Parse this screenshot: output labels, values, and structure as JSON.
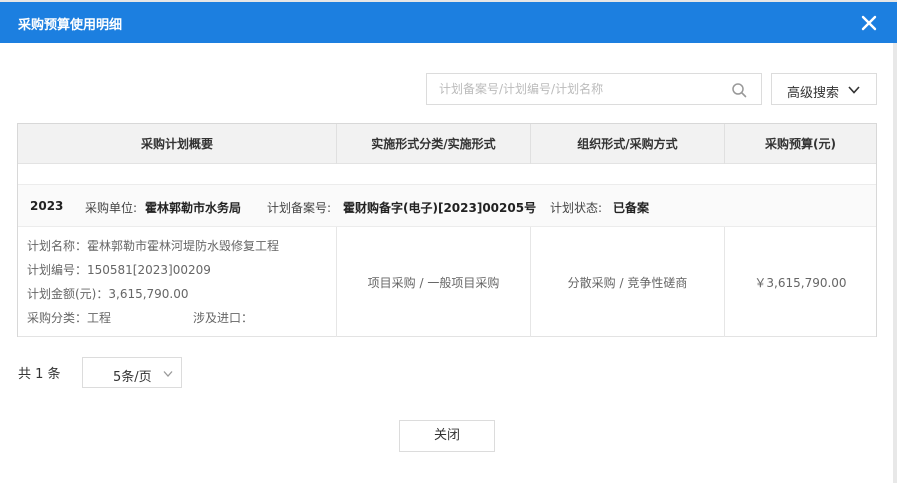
{
  "dialog": {
    "title": "采购预算使用明细",
    "accent_color": "#1c7fe0",
    "close_icon": "close-icon"
  },
  "search": {
    "placeholder": "计划备案号/计划编号/计划名称",
    "value": "",
    "icon": "search-icon"
  },
  "advanced_search": {
    "label": "高级搜索",
    "icon": "chevron-down-icon"
  },
  "table": {
    "columns": [
      "采购计划概要",
      "实施形式分类/实施形式",
      "组织形式/采购方式",
      "采购预算(元)"
    ],
    "group": {
      "year": "2023",
      "unit_label": "采购单位:",
      "unit_value": "霍林郭勒市水务局",
      "filing_label": "计划备案号:",
      "filing_value": "霍财购备字(电子)[2023]00205号",
      "status_label": "计划状态:",
      "status_value": "已备案"
    },
    "rows": [
      {
        "plan_name": "计划名称：霍林郭勒市霍林河堤防水毁修复工程",
        "plan_no": "计划编号：150581[2023]00209",
        "plan_amount": "计划金额(元)：3,615,790.00",
        "category": "采购分类：工程",
        "import": "涉及进口：",
        "impl_form": "项目采购 / 一般项目采购",
        "org_form": "分散采购 / 竞争性磋商",
        "budget": "￥3,615,790.00"
      }
    ]
  },
  "pagination": {
    "total": "共 1 条",
    "page_size": "5条/页"
  },
  "footer": {
    "close_label": "关闭"
  }
}
